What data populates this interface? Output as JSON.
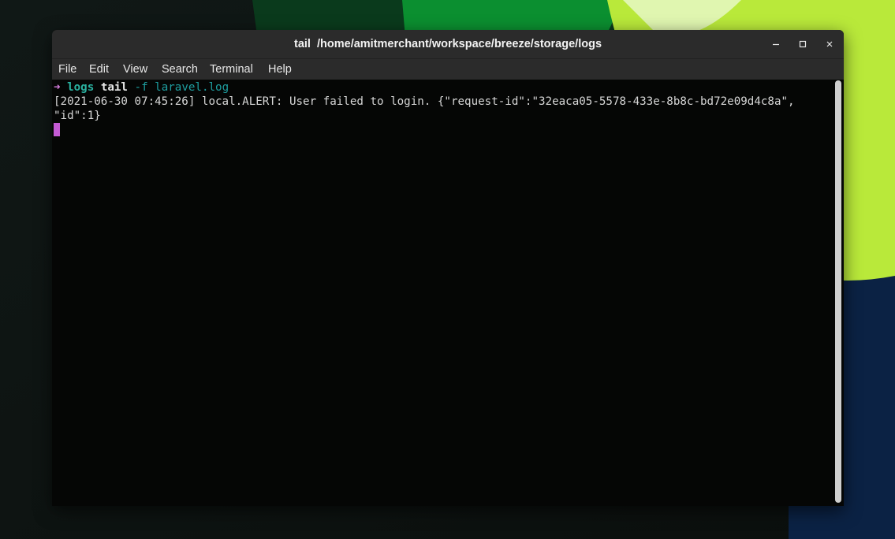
{
  "window": {
    "title": "tail  /home/amitmerchant/workspace/breeze/storage/logs",
    "buttons": {
      "minimize_icon": "minimize-icon",
      "maximize_icon": "maximize-icon",
      "close_icon": "close-icon"
    }
  },
  "menu": {
    "items": [
      "File",
      "Edit",
      "View",
      "Search",
      "Terminal",
      "Help"
    ]
  },
  "terminal": {
    "prompt_arrow": "➜",
    "prompt_dir": "logs",
    "command": "tail",
    "command_args": "-f laravel.log",
    "output_lines": [
      "[2021-06-30 07:45:26] local.ALERT: User failed to login. {\"request-id\":\"32eaca05-5578-433e-8b8c-bd72e09d4c8a\",",
      "\"id\":1}"
    ]
  },
  "colors": {
    "prompt_arrow": "#d77ee0",
    "prompt_dir": "#2ab1a0",
    "args": "#1e9ea0",
    "cursor": "#c45bd4",
    "titlebar": "#2b2b2b"
  }
}
